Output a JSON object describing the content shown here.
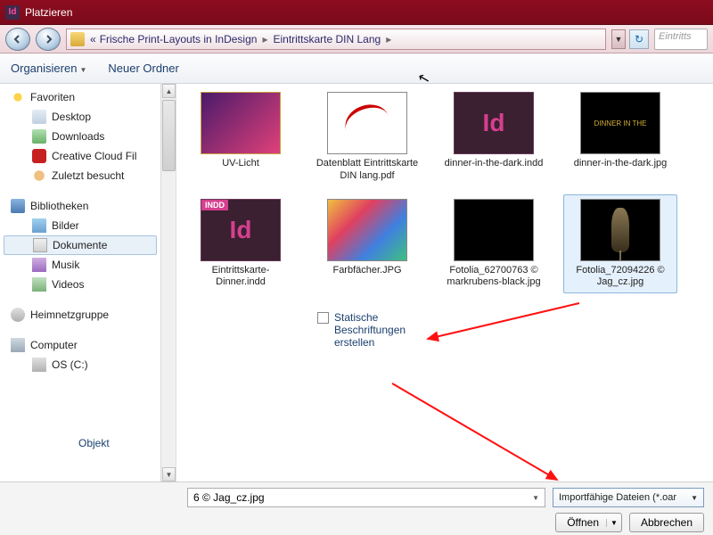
{
  "window": {
    "title": "Platzieren"
  },
  "breadcrumb": {
    "prefix": "«",
    "parts": [
      "Frische Print-Layouts in InDesign",
      "Eintrittskarte DIN Lang"
    ]
  },
  "search": {
    "placeholder": "Eintritts"
  },
  "toolbar": {
    "organize": "Organisieren",
    "newfolder": "Neuer Ordner"
  },
  "sidebar": {
    "favorites": "Favoriten",
    "desktop": "Desktop",
    "downloads": "Downloads",
    "creativecloud": "Creative Cloud Fil",
    "recent": "Zuletzt besucht",
    "libraries": "Bibliotheken",
    "pictures": "Bilder",
    "documents": "Dokumente",
    "music": "Musik",
    "videos": "Videos",
    "homegroup": "Heimnetzgruppe",
    "computer": "Computer",
    "osdrive": "OS (C:)"
  },
  "files": [
    {
      "label": "UV-Licht",
      "thumb": "uv"
    },
    {
      "label": "Datenblatt Eintrittskarte DIN lang.pdf",
      "thumb": "pdf"
    },
    {
      "label": "dinner-in-the-dark.indd",
      "thumb": "indd"
    },
    {
      "label": "dinner-in-the-dark.jpg",
      "thumb": "dark-text"
    },
    {
      "label": "Eintrittskarte-Dinner.indd",
      "thumb": "indd"
    },
    {
      "label": "Farbfächer.JPG",
      "thumb": "colorful"
    },
    {
      "label": "Fotolia_62700763 © markrubens-black.jpg",
      "thumb": "black"
    },
    {
      "label": "Fotolia_72094226 © Jag_cz.jpg",
      "thumb": "champagne",
      "selected": true
    }
  ],
  "options": {
    "static_captions": "Statische Beschriftungen erstellen",
    "objekt": "Objekt"
  },
  "bottom": {
    "filename": "6 © Jag_cz.jpg",
    "filter": "Importfähige Dateien (*.oar",
    "open": "Öffnen",
    "cancel": "Abbrechen"
  },
  "icons": {
    "indd_badge": "INDD",
    "indd_big": "Id",
    "dark_text": "DINNER IN THE"
  }
}
